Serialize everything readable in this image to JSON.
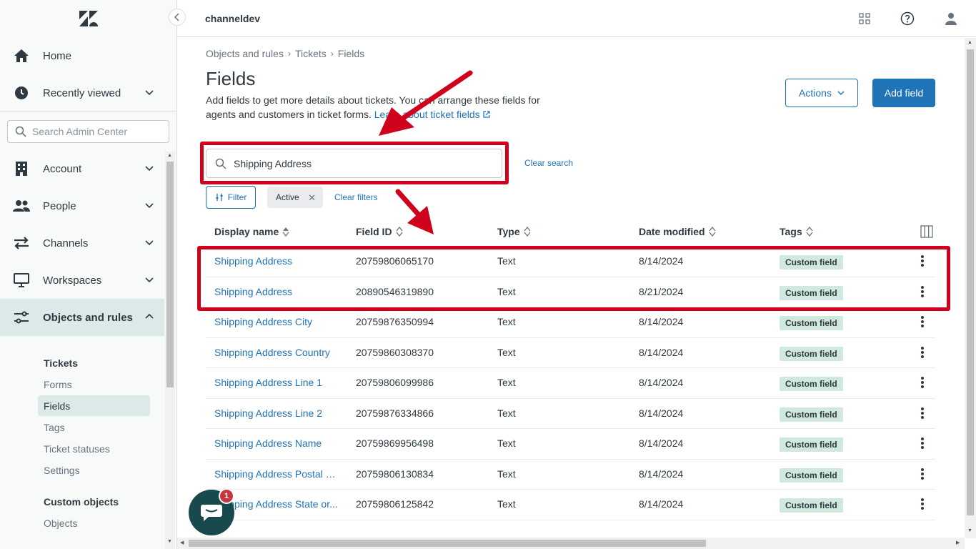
{
  "header": {
    "brand": "channeldev"
  },
  "sidebar": {
    "nav": [
      {
        "label": "Home",
        "icon": "home-icon"
      },
      {
        "label": "Recently viewed",
        "icon": "clock-icon"
      },
      {
        "label": "Account",
        "icon": "building-icon"
      },
      {
        "label": "People",
        "icon": "people-icon"
      },
      {
        "label": "Channels",
        "icon": "arrows-icon"
      },
      {
        "label": "Workspaces",
        "icon": "monitor-icon"
      },
      {
        "label": "Objects and rules",
        "icon": "objects-icon"
      }
    ],
    "search_placeholder": "Search Admin Center",
    "subnav": {
      "tickets_title": "Tickets",
      "tickets_items": [
        "Forms",
        "Fields",
        "Tags",
        "Ticket statuses",
        "Settings"
      ],
      "custom_title": "Custom objects",
      "custom_items": [
        "Objects"
      ]
    }
  },
  "breadcrumb": [
    "Objects and rules",
    "Tickets",
    "Fields"
  ],
  "page": {
    "title": "Fields",
    "description": "Add fields to get more details about tickets. You can arrange these fields for agents and customers in ticket forms.",
    "learn_link": "Learn about ticket fields",
    "actions_label": "Actions",
    "add_label": "Add field"
  },
  "search": {
    "value": "Shipping Address",
    "clear_label": "Clear search"
  },
  "filters": {
    "filter_label": "Filter",
    "chip_label": "Active",
    "clear_label": "Clear filters"
  },
  "table": {
    "columns": [
      "Display name",
      "Field ID",
      "Type",
      "Date modified",
      "Tags"
    ],
    "rows": [
      {
        "name": "Shipping Address",
        "id": "20759806065170",
        "type": "Text",
        "date": "8/14/2024",
        "tag": "Custom field"
      },
      {
        "name": "Shipping Address",
        "id": "20890546319890",
        "type": "Text",
        "date": "8/21/2024",
        "tag": "Custom field"
      },
      {
        "name": "Shipping Address City",
        "id": "20759876350994",
        "type": "Text",
        "date": "8/14/2024",
        "tag": "Custom field"
      },
      {
        "name": "Shipping Address Country",
        "id": "20759860308370",
        "type": "Text",
        "date": "8/14/2024",
        "tag": "Custom field"
      },
      {
        "name": "Shipping Address Line 1",
        "id": "20759806099986",
        "type": "Text",
        "date": "8/14/2024",
        "tag": "Custom field"
      },
      {
        "name": "Shipping Address Line 2",
        "id": "20759876334866",
        "type": "Text",
        "date": "8/14/2024",
        "tag": "Custom field"
      },
      {
        "name": "Shipping Address Name",
        "id": "20759869956498",
        "type": "Text",
        "date": "8/14/2024",
        "tag": "Custom field"
      },
      {
        "name": "Shipping Address Postal C...",
        "id": "20759806130834",
        "type": "Text",
        "date": "8/14/2024",
        "tag": "Custom field"
      },
      {
        "name": "Shipping Address State or...",
        "id": "20759806125842",
        "type": "Text",
        "date": "8/14/2024",
        "tag": "Custom field"
      }
    ]
  },
  "chat": {
    "badge": "1"
  },
  "colors": {
    "accent": "#1f73b7",
    "annotation": "#d0021b",
    "tag_bg": "#d1e8df",
    "active_nav": "#dbeae8"
  }
}
